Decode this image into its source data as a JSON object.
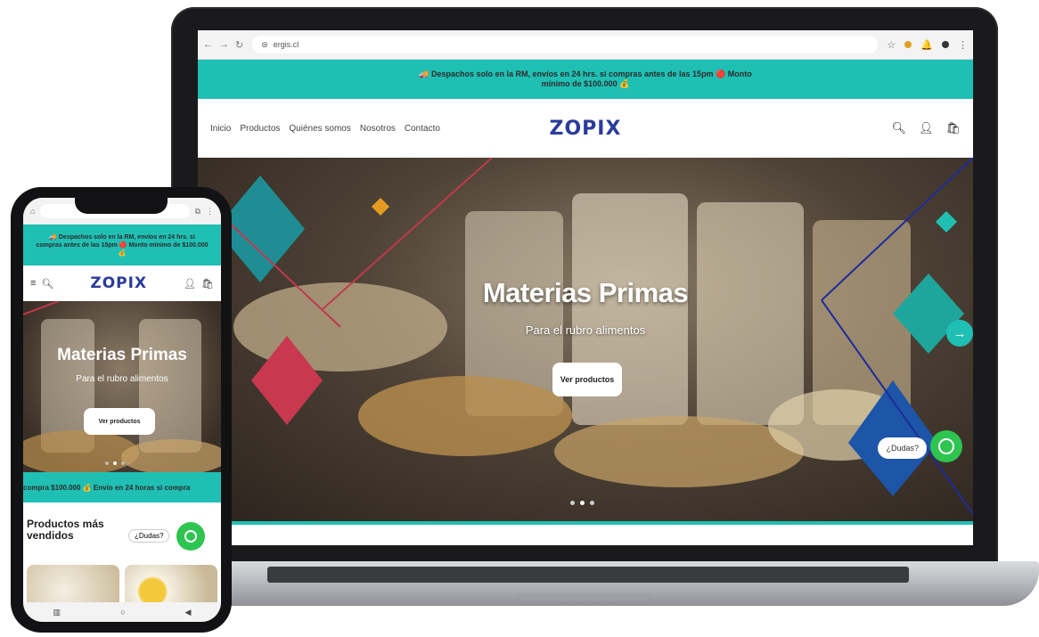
{
  "laptop": {
    "browser": {
      "url": "ergis.cl",
      "nav_icons": [
        "back-icon",
        "forward-icon",
        "reload-icon"
      ]
    },
    "promo_text": "🚚 Despachos solo en la RM, envíos en 24 hrs. si compras antes de las 15pm 🔴 Monto mínimo de $100.000 💰",
    "menu": [
      "Inicio",
      "Productos",
      "Quiénes somos",
      "Nosotros",
      "Contacto"
    ],
    "logo": "ZOPIX",
    "hero": {
      "title": "Materias Primas",
      "subtitle": "Para el rubro alimentos",
      "button": "Ver productos",
      "dudas": "¿Dudas?"
    },
    "colors": {
      "accent": "#20bfb4",
      "logo": "#2a3c9a",
      "whatsapp": "#2ec450"
    }
  },
  "phone": {
    "promo_text": "🚚 Despachos solo en la RM, envíos en 24 hrs. si compras antes de las 15pm 🔴 Monto mínimo de $100.000 💰",
    "logo": "ZOPIX",
    "hero": {
      "title": "Materias Primas",
      "subtitle": "Para el rubro alimentos",
      "button": "Ver productos"
    },
    "marquee": "compra $100.000 💰 Envío en 24 horas si compra",
    "section_title": "Productos más vendidos",
    "dudas": "¿Dudas?"
  }
}
